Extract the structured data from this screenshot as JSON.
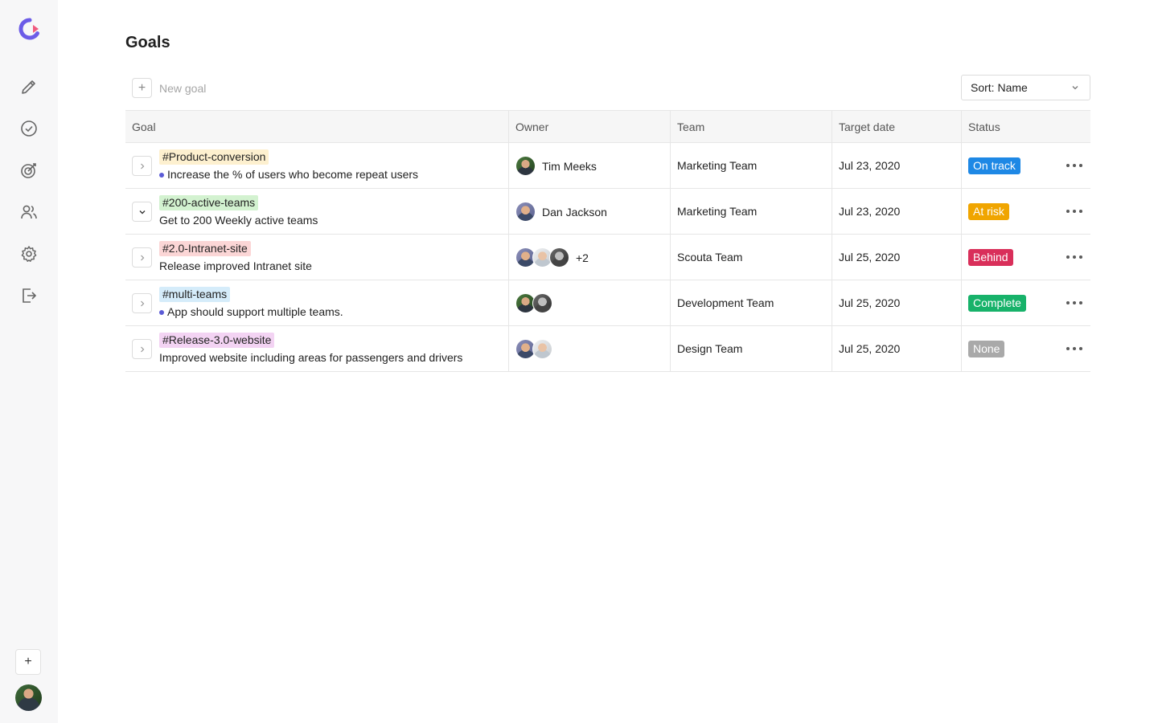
{
  "app": {
    "title": "Goals",
    "brand_color": "#5b5bd6"
  },
  "sidebar": {
    "logo_icon": "app-logo-icon",
    "items": [
      {
        "name": "edit",
        "icon": "pencil-icon"
      },
      {
        "name": "tasks",
        "icon": "check-circle-icon"
      },
      {
        "name": "goals",
        "icon": "target-icon"
      },
      {
        "name": "people",
        "icon": "users-icon"
      },
      {
        "name": "settings",
        "icon": "gear-icon"
      },
      {
        "name": "logout",
        "icon": "logout-icon"
      }
    ],
    "add_label": "+"
  },
  "toolbar": {
    "new_goal_label": "New goal",
    "sort_label": "Sort: Name"
  },
  "table": {
    "columns": [
      "Goal",
      "Owner",
      "Team",
      "Target date",
      "Status"
    ],
    "rows": [
      {
        "tag": "#Product-conversion",
        "tag_color": "#fdf0cf",
        "title": "Increase the % of users who become repeat users",
        "has_bullet": true,
        "expanded": false,
        "owner_name": "Tim Meeks",
        "owner_avatars": [
          "a"
        ],
        "extra_owners": "",
        "team": "Marketing Team",
        "target_date": "Jul 23, 2020",
        "status": "On track",
        "status_color": "#1e88e5"
      },
      {
        "tag": "#200-active-teams",
        "tag_color": "#d3f2d0",
        "title": "Get to 200 Weekly active teams",
        "has_bullet": false,
        "expanded": true,
        "owner_name": "Dan Jackson",
        "owner_avatars": [
          "b"
        ],
        "extra_owners": "",
        "team": "Marketing Team",
        "target_date": "Jul 23, 2020",
        "status": "At risk",
        "status_color": "#f0a500"
      },
      {
        "tag": "#2.0-Intranet-site",
        "tag_color": "#fbd6d6",
        "title": "Release improved Intranet site",
        "has_bullet": false,
        "expanded": false,
        "owner_name": "",
        "owner_avatars": [
          "b",
          "c",
          "d"
        ],
        "extra_owners": "+2",
        "team": "Scouta Team",
        "target_date": "Jul 25, 2020",
        "status": "Behind",
        "status_color": "#d92f5a"
      },
      {
        "tag": "#multi-teams",
        "tag_color": "#d5ecfa",
        "title": "App should support multiple teams.",
        "has_bullet": true,
        "expanded": false,
        "owner_name": "",
        "owner_avatars": [
          "a",
          "d"
        ],
        "extra_owners": "",
        "team": "Development Team",
        "target_date": "Jul 25, 2020",
        "status": "Complete",
        "status_color": "#17b26a"
      },
      {
        "tag": "#Release-3.0-website",
        "tag_color": "#f3d3f3",
        "title": "Improved website including areas for passengers and drivers",
        "has_bullet": false,
        "expanded": false,
        "owner_name": "",
        "owner_avatars": [
          "b",
          "c"
        ],
        "extra_owners": "",
        "team": "Design Team",
        "target_date": "Jul 25, 2020",
        "status": "None",
        "status_color": "#a9a9a9"
      }
    ]
  }
}
